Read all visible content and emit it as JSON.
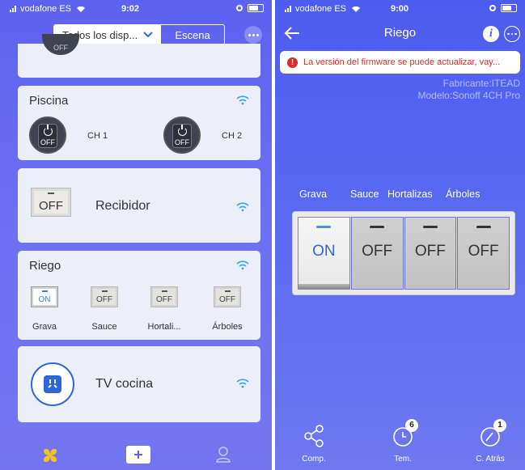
{
  "left": {
    "status": {
      "carrier": "vodafone ES",
      "time": "9:02"
    },
    "topbar": {
      "devices_label": "Todos los disp...",
      "scene_label": "Escena"
    },
    "piscina": {
      "title": "Piscina",
      "ch1": "CH 1",
      "ch2": "CH 2",
      "off": "OFF",
      "partial_off": "OFF"
    },
    "recibidor": {
      "state": "OFF",
      "name": "Recibidor"
    },
    "riego": {
      "title": "Riego",
      "switches": [
        {
          "state": "ON",
          "name": "Grava"
        },
        {
          "state": "OFF",
          "name": "Sauce"
        },
        {
          "state": "OFF",
          "name": "Hortali..."
        },
        {
          "state": "OFF",
          "name": "Árboles"
        }
      ]
    },
    "tv": {
      "name": "TV cocina"
    }
  },
  "right": {
    "status": {
      "carrier": "vodafone ES",
      "time": "9:00"
    },
    "title": "Riego",
    "banner": "La versión del firmware se puede actualizar, vay...",
    "manufacturer": "Fabricante:ITEAD",
    "model": "Modelo:Sonoff 4CH Pro",
    "channels": [
      {
        "name": "Grava",
        "state": "ON"
      },
      {
        "name": "Sauce",
        "state": "OFF"
      },
      {
        "name": "Hortalizas",
        "state": "OFF"
      },
      {
        "name": "Árboles",
        "state": "OFF"
      }
    ],
    "bottom": {
      "share": "Comp.",
      "timer": "Tem.",
      "timer_count": "6",
      "countdown": "C. Atrás",
      "countdown_count": "1"
    }
  },
  "colors": {
    "accent": "#2f66d9",
    "warning": "#d92c2c",
    "wifi": "#2aa8e8",
    "yellow": "#f4c21f"
  }
}
